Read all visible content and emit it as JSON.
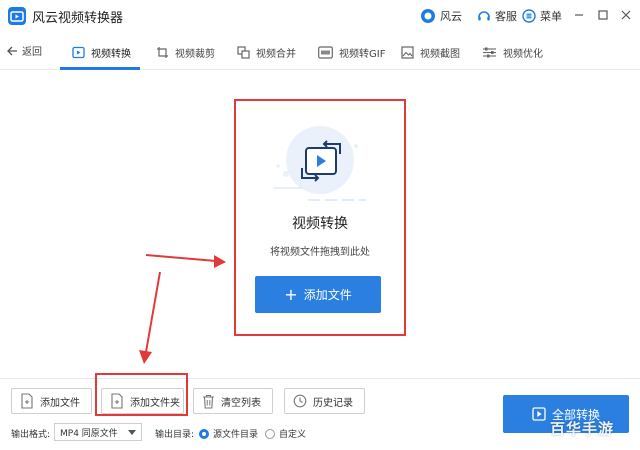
{
  "app": {
    "title": "风云视频转换器"
  },
  "titlebar": {
    "brand_label": "风云",
    "service_label": "客服",
    "menu_label": "菜单"
  },
  "nav": {
    "back_label": "返回",
    "tabs": [
      {
        "label": "视频转换",
        "icon": "video-convert-icon",
        "active": true
      },
      {
        "label": "视频裁剪",
        "icon": "crop-icon"
      },
      {
        "label": "视频合并",
        "icon": "merge-icon"
      },
      {
        "label": "视频转GIF",
        "icon": "gif-icon"
      },
      {
        "label": "视频截图",
        "icon": "screenshot-icon"
      },
      {
        "label": "视频优化",
        "icon": "sliders-icon"
      }
    ]
  },
  "dropzone": {
    "title": "视频转换",
    "subtitle": "将视频文件拖拽到此处",
    "add_button": "添加文件"
  },
  "toolbar": {
    "add_file": "添加文件",
    "add_folder": "添加文件夹",
    "clear_list": "清空列表",
    "history": "历史记录"
  },
  "output": {
    "format_label": "输出格式:",
    "format_value": "MP4 同原文件",
    "dir_label": "输出目录:",
    "dir_options": [
      {
        "label": "源文件目录",
        "selected": true
      },
      {
        "label": "自定义",
        "selected": false
      }
    ]
  },
  "convert_all": "全部转换",
  "watermark": "百华手游",
  "colors": {
    "accent": "#2b7fe0",
    "annotation": "#e23a3a"
  }
}
